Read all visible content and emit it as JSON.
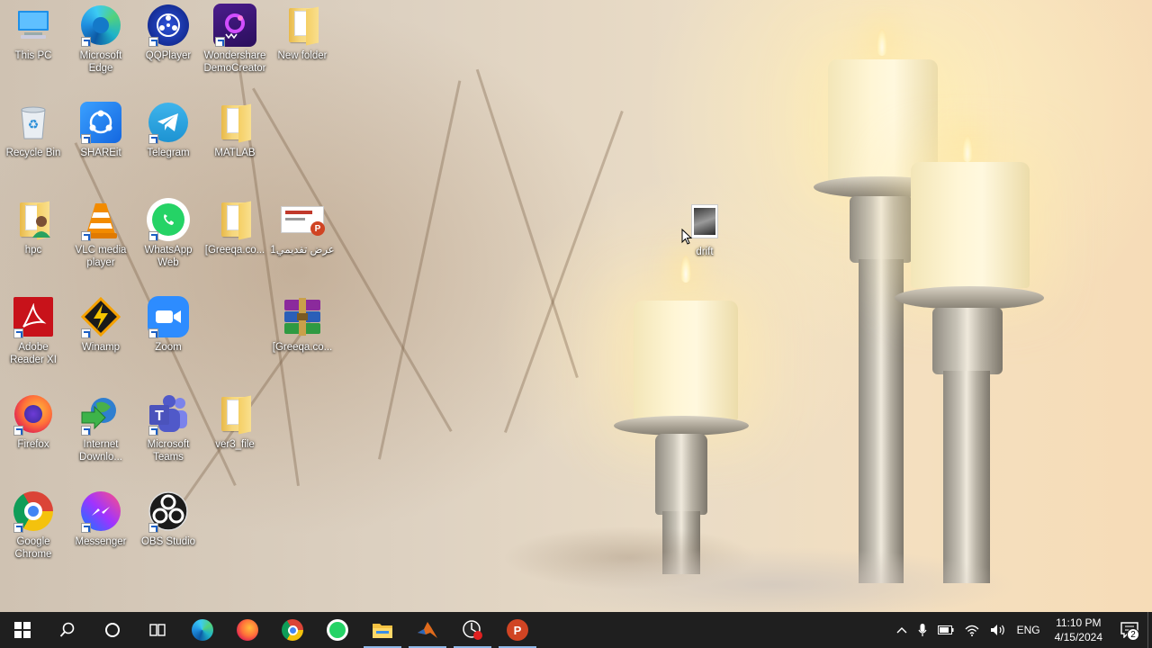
{
  "desktop": {
    "icons": [
      {
        "label": "This PC",
        "icon": "this-pc-icon"
      },
      {
        "label": "Microsoft Edge",
        "icon": "edge-icon"
      },
      {
        "label": "QQPlayer",
        "icon": "qqplayer-icon"
      },
      {
        "label": "Wondershare DemoCreator",
        "icon": "democreator-icon"
      },
      {
        "label": "New folder",
        "icon": "folder-icon"
      },
      {
        "label": "Recycle Bin",
        "icon": "recycle-bin-icon"
      },
      {
        "label": "SHAREit",
        "icon": "shareit-icon"
      },
      {
        "label": "Telegram",
        "icon": "telegram-icon"
      },
      {
        "label": "MATLAB",
        "icon": "folder-icon"
      },
      {
        "label": "hpc",
        "icon": "user-folder-icon"
      },
      {
        "label": "VLC media player",
        "icon": "vlc-icon"
      },
      {
        "label": "WhatsApp Web",
        "icon": "whatsapp-icon"
      },
      {
        "label": "[Greeqa.co...",
        "icon": "folder-icon"
      },
      {
        "label": "عرض تقديمي1",
        "icon": "powerpoint-file-icon"
      },
      {
        "label": "drift",
        "icon": "image-file-icon"
      },
      {
        "label": "Adobe Reader XI",
        "icon": "adobe-reader-icon"
      },
      {
        "label": "Winamp",
        "icon": "winamp-icon"
      },
      {
        "label": "Zoom",
        "icon": "zoom-icon"
      },
      {
        "label": "[Greeqa.co...",
        "icon": "winrar-archive-icon"
      },
      {
        "label": "Firefox",
        "icon": "firefox-icon"
      },
      {
        "label": "Internet Downlo...",
        "icon": "internet-download-manager-icon"
      },
      {
        "label": "Microsoft Teams",
        "icon": "teams-icon"
      },
      {
        "label": "ver3_file",
        "icon": "folder-icon"
      },
      {
        "label": "Google Chrome",
        "icon": "chrome-icon"
      },
      {
        "label": "Messenger",
        "icon": "messenger-icon"
      },
      {
        "label": "OBS Studio",
        "icon": "obs-icon"
      }
    ]
  },
  "taskbar": {
    "buttons": [
      {
        "name": "start",
        "icon": "windows-logo-icon"
      },
      {
        "name": "search",
        "icon": "search-icon"
      },
      {
        "name": "cortana",
        "icon": "cortana-circle-icon"
      },
      {
        "name": "task-view",
        "icon": "task-view-icon"
      },
      {
        "name": "edge",
        "icon": "edge-icon"
      },
      {
        "name": "firefox",
        "icon": "firefox-icon"
      },
      {
        "name": "chrome",
        "icon": "chrome-icon"
      },
      {
        "name": "whatsapp",
        "icon": "whatsapp-icon"
      },
      {
        "name": "file-explorer",
        "icon": "file-explorer-icon",
        "active": true
      },
      {
        "name": "matlab",
        "icon": "matlab-icon",
        "active": true
      },
      {
        "name": "screen-recorder",
        "icon": "recorder-icon",
        "active": true
      },
      {
        "name": "powerpoint",
        "icon": "powerpoint-icon",
        "active": true
      }
    ],
    "tray": {
      "language": "ENG",
      "time": "11:10 PM",
      "date": "4/15/2024",
      "notification_count": "2"
    }
  },
  "colors": {
    "taskbar_bg": "#1f1f1f",
    "active_indicator": "#8fb8e8"
  }
}
